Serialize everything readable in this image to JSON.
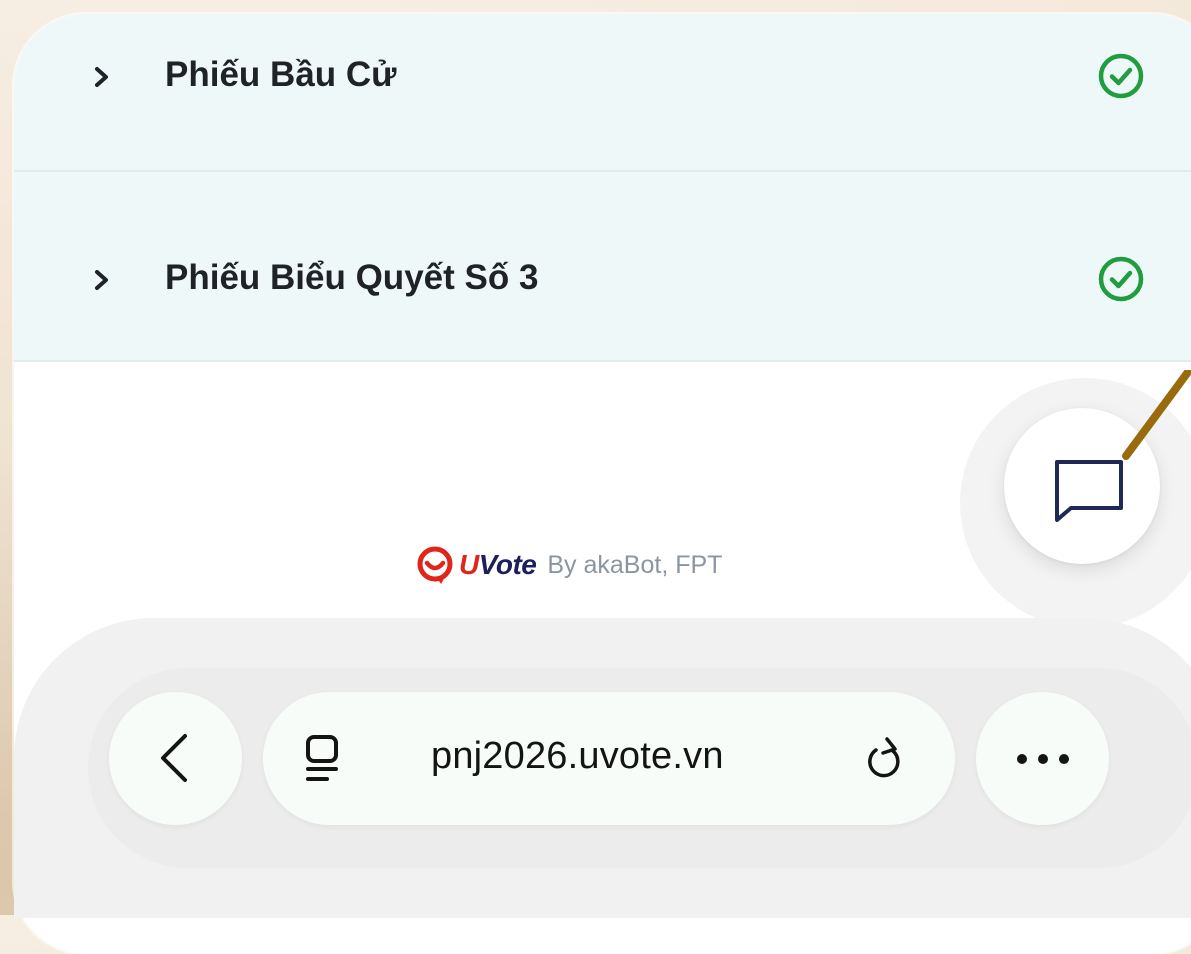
{
  "ballots": [
    {
      "label": "Phiếu Bầu Cử",
      "status": "completed",
      "expand_icon": "chevron-right-icon",
      "status_icon": "check-circle-icon"
    },
    {
      "label": "Phiếu Biểu Quyết Số 3",
      "status": "completed",
      "expand_icon": "chevron-right-icon",
      "status_icon": "check-circle-icon"
    }
  ],
  "brand": {
    "logo_initial": "U",
    "logo_rest": "Vote",
    "byline": "By akaBot, FPT"
  },
  "chat": {
    "icon": "chat-bubble-icon"
  },
  "browser": {
    "url": "pnj2026.uvote.vn",
    "back_icon": "chevron-left-icon",
    "tabs_icon": "tabs-icon",
    "reload_icon": "reload-icon",
    "more_icon": "more-horizontal-icon"
  },
  "colors": {
    "row_background": "#eff8f8",
    "check_green": "#1f9d3f",
    "brand_red": "#e1251b",
    "brand_navy": "#1c1f5e",
    "chat_icon": "#1c2a55",
    "annotation": "#9a6b0c"
  }
}
